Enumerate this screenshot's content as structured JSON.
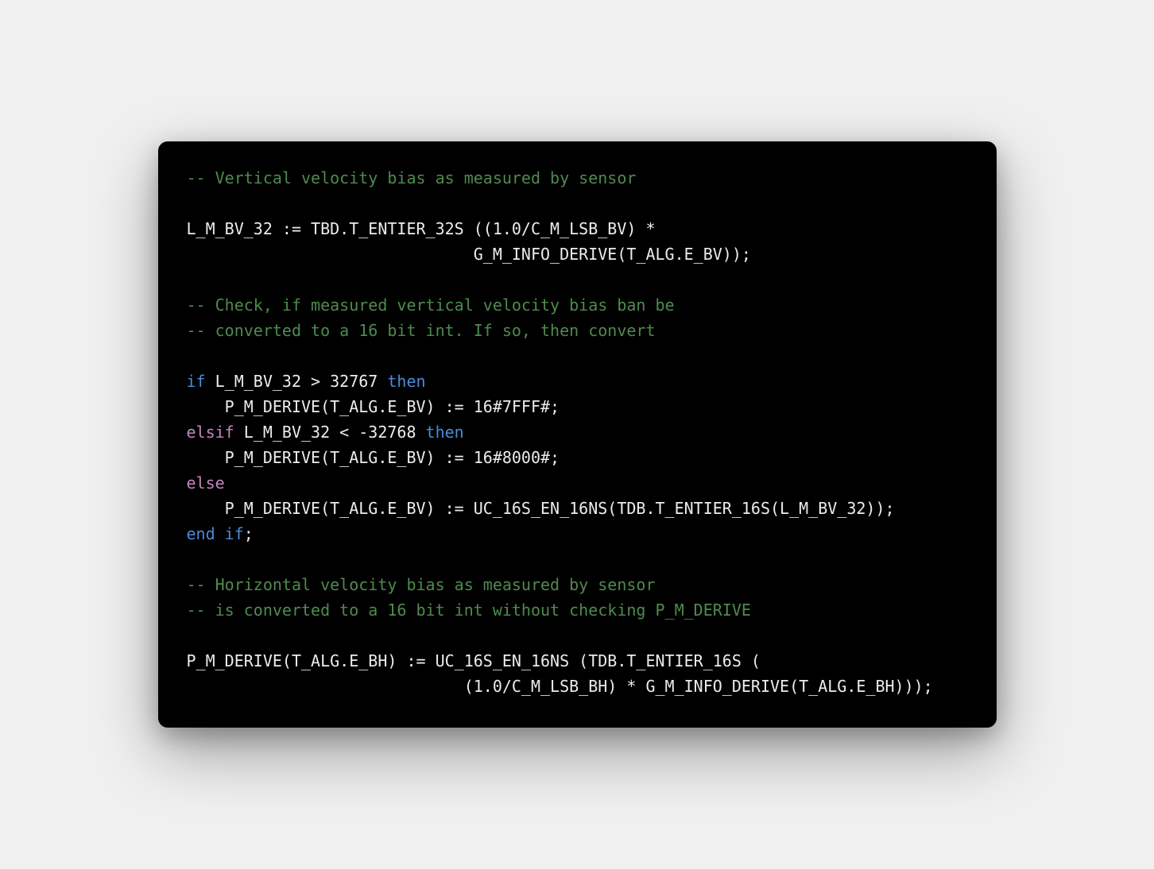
{
  "code": {
    "c1": "-- Vertical velocity bias as measured by sensor",
    "blank": "",
    "l1a": "L_M_BV_32 := TBD.T_ENTIER_32S ((1.0/C_M_LSB_BV) *",
    "l1b": "                              G_M_INFO_DERIVE(T_ALG.E_BV));",
    "c2a": "-- Check, if measured vertical velocity bias ban be",
    "c2b": "-- converted to a 16 bit int. If so, then convert",
    "kw_if": "if",
    "if_cond": " L_M_BV_32 > 32767 ",
    "kw_then": "then",
    "if_body": "    P_M_DERIVE(T_ALG.E_BV) := 16#7FFF#;",
    "kw_elsif": "elsif",
    "elsif_cond": " L_M_BV_32 < -32768 ",
    "elsif_body": "    P_M_DERIVE(T_ALG.E_BV) := 16#8000#;",
    "kw_else": "else",
    "else_body": "    P_M_DERIVE(T_ALG.E_BV) := UC_16S_EN_16NS(TDB.T_ENTIER_16S(L_M_BV_32));",
    "kw_end": "end",
    "kw_end_if": "if",
    "semicolon": ";",
    "c3a": "-- Horizontal velocity bias as measured by sensor",
    "c3b": "-- is converted to a 16 bit int without checking P_M_DERIVE",
    "l4a": "P_M_DERIVE(T_ALG.E_BH) := UC_16S_EN_16NS (TDB.T_ENTIER_16S (",
    "l4b": "                             (1.0/C_M_LSB_BH) * G_M_INFO_DERIVE(T_ALG.E_BH)));"
  }
}
